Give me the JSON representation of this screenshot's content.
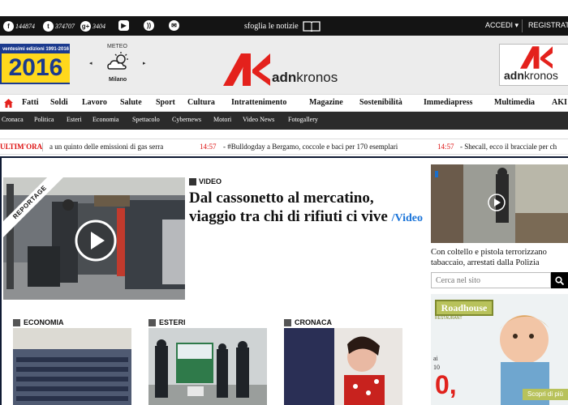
{
  "topbar": {
    "facebook": {
      "icon": "facebook-icon",
      "count": "144874"
    },
    "twitter": {
      "icon": "twitter-icon",
      "count": "374707"
    },
    "googleplus": {
      "icon": "googleplus-icon",
      "count": "3404"
    },
    "youtube_icon": "youtube-icon",
    "rss_icon": "rss-icon",
    "mail_icon": "mail-icon",
    "sfoglia": "sfoglia le notizie",
    "accedi": "ACCEDI ▾",
    "registrati": "REGISTRATI"
  },
  "header": {
    "badge_edition": "ventesimi edizioni 1991-2016",
    "badge_year": "2016",
    "meteo_label": "METEO",
    "meteo_prev": "◂",
    "meteo_next": "▸",
    "meteo_city": "Milano",
    "logo_brand_a": "adn",
    "logo_brand_b": "kronos",
    "logo_box_a": "adn",
    "logo_box_b": "kronos",
    "brand_color": "#e4211c"
  },
  "mainnav": [
    "Fatti",
    "Soldi",
    "Lavoro",
    "Salute",
    "Sport",
    "Cultura",
    "Intrattenimento",
    "Magazine",
    "Sostenibilità",
    "Immediapress",
    "Multimedia",
    "AKI"
  ],
  "subnav": [
    "Cronaca",
    "Politica",
    "Esteri",
    "Economia",
    "Spettacolo",
    "Cybernews",
    "Motori",
    "Video News",
    "Fotogallery"
  ],
  "ticker": {
    "label": "ULTIM'ORA",
    "items": [
      {
        "time": "",
        "text": "a un quinto delle emissioni di gas serra"
      },
      {
        "time": "14:57",
        "text": "- #Bulldogday a Bergamo, coccole e baci per 170 esemplari"
      },
      {
        "time": "14:57",
        "text": "- Shecall, ecco il bracciale per ch"
      }
    ]
  },
  "lead": {
    "ribbon": "REPORTAGE",
    "tag": "VIDEO",
    "headline": "Dal cassonetto al mercatino, viaggio tra chi di rifiuti ci vive",
    "video_link": "/Video"
  },
  "sections": [
    {
      "label": "ECONOMIA"
    },
    {
      "label": "ESTERI"
    },
    {
      "label": "CRONACA"
    }
  ],
  "side": {
    "headline": "Con coltello e pistola terrorizzano tabaccaio, arrestati dalla Polizia",
    "search_placeholder": "Cerca nel sito"
  },
  "ad": {
    "brand": "Roadhouse",
    "brand_sub": "RESTAURANT",
    "line1": "ai",
    "line2": "10",
    "price": "0,",
    "cta": "Scopri di più"
  }
}
